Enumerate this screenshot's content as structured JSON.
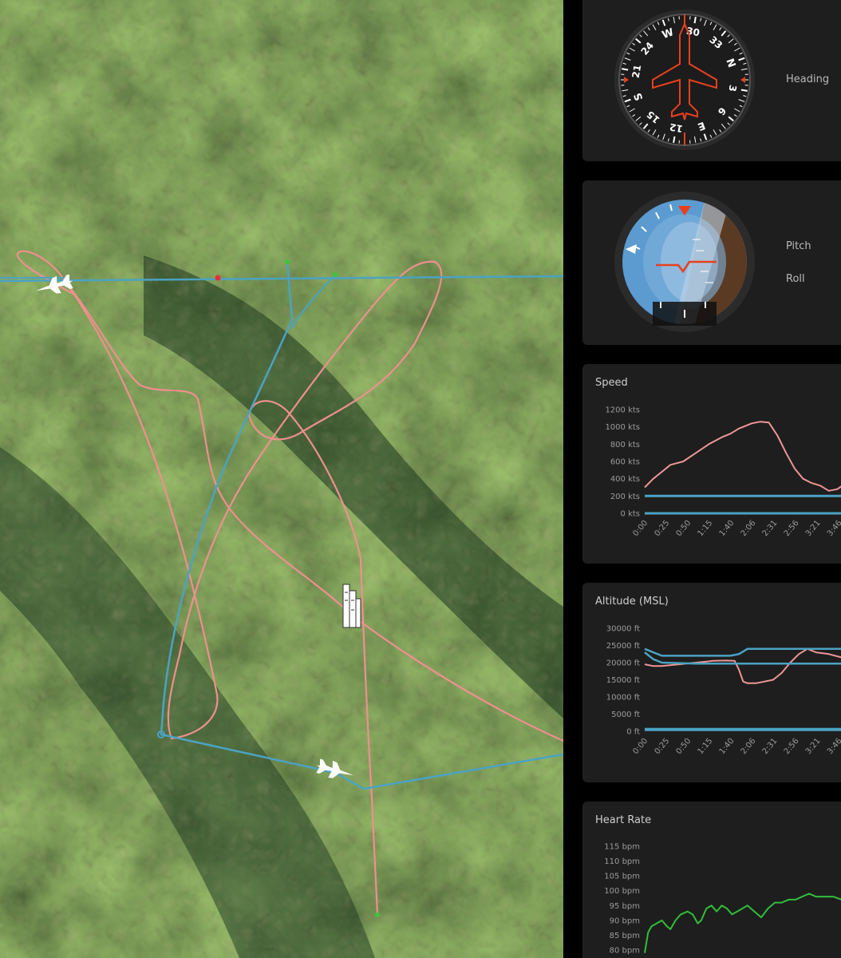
{
  "map": {
    "colors": {
      "track_red": "#ef8f8f",
      "track_blue": "#4aa3c4",
      "waypoint_green": "#37c837",
      "waypoint_red": "#e83030"
    },
    "icons": [
      "fighter-jet-icon",
      "fighter-jet-icon",
      "city-tower-icon"
    ]
  },
  "heading": {
    "label": "Heading",
    "dial_labels": [
      "30",
      "33",
      "N",
      "3",
      "6",
      "E",
      "12",
      "15",
      "S",
      "21",
      "24",
      "W"
    ]
  },
  "attitude": {
    "pitch_label": "Pitch",
    "roll_label": "Roll"
  },
  "speed_chart": {
    "title": "Speed",
    "accent": "#ef9696",
    "ref_color": "#4aa3c4"
  },
  "altitude_chart": {
    "title": "Altitude (MSL)",
    "accent": "#ef9696",
    "ref_color": "#4aa3c4"
  },
  "heart_chart": {
    "title": "Heart Rate",
    "accent": "#2fbf3a"
  },
  "chart_data": [
    {
      "type": "line",
      "title": "Speed",
      "xlabel": "",
      "ylabel": "",
      "x": [
        "0:00",
        "0:25",
        "0:50",
        "1:15",
        "1:40",
        "2:06",
        "2:31",
        "2:56",
        "3:21",
        "3:46"
      ],
      "yticks": [
        "0 kts",
        "200 kts",
        "400 kts",
        "600 kts",
        "800 kts",
        "1000 kts",
        "1200 kts"
      ],
      "ylim": [
        0,
        1200
      ],
      "xlim": [
        0,
        246
      ],
      "series": [
        {
          "x": [
            0,
            10,
            20,
            30,
            45,
            60,
            75,
            90,
            100,
            110,
            115,
            125,
            135,
            145,
            155,
            165,
            175,
            185,
            195,
            205,
            215,
            225,
            235,
            240,
            246
          ],
          "values": [
            300,
            400,
            480,
            560,
            600,
            700,
            800,
            880,
            920,
            980,
            1000,
            1040,
            1060,
            1050,
            900,
            700,
            520,
            400,
            350,
            320,
            260,
            280,
            350,
            400,
            420
          ]
        },
        {
          "x": [
            0,
            246
          ],
          "values": [
            200,
            200
          ]
        },
        {
          "x": [
            0,
            246
          ],
          "values": [
            0,
            0
          ]
        }
      ]
    },
    {
      "type": "line",
      "title": "Altitude (MSL)",
      "xlabel": "",
      "ylabel": "",
      "x": [
        "0:00",
        "0:25",
        "0:50",
        "1:15",
        "1:40",
        "2:06",
        "2:31",
        "2:56",
        "3:21",
        "3:46"
      ],
      "yticks": [
        "0 ft",
        "5000 ft",
        "10000 ft",
        "15000 ft",
        "20000 ft",
        "25000 ft",
        "30000 ft"
      ],
      "ylim": [
        0,
        30000
      ],
      "xlim": [
        0,
        246
      ],
      "series": [
        {
          "x": [
            0,
            10,
            20,
            40,
            60,
            80,
            95,
            105,
            110,
            115,
            120,
            130,
            140,
            150,
            160,
            170,
            180,
            190,
            200,
            215,
            230,
            246
          ],
          "values": [
            19500,
            19000,
            19000,
            19500,
            20000,
            20500,
            20600,
            20500,
            18000,
            14500,
            14000,
            14000,
            14500,
            15000,
            17000,
            20000,
            22500,
            24000,
            23000,
            22500,
            21500,
            20500
          ]
        },
        {
          "x": [
            0,
            10,
            20,
            60,
            100,
            110,
            120,
            140,
            180,
            220,
            246
          ],
          "values": [
            24000,
            23000,
            22000,
            22000,
            22000,
            22500,
            24000,
            24000,
            24000,
            24000,
            24000
          ]
        },
        {
          "x": [
            0,
            10,
            20,
            60,
            100,
            140,
            180,
            220,
            246
          ],
          "values": [
            23000,
            21000,
            20000,
            19700,
            19700,
            19700,
            19700,
            19700,
            19700
          ]
        },
        {
          "x": [
            0,
            246
          ],
          "values": [
            500,
            500
          ]
        }
      ]
    },
    {
      "type": "line",
      "title": "Heart Rate",
      "xlabel": "",
      "ylabel": "",
      "yticks": [
        "80 bpm",
        "85 bpm",
        "90 bpm",
        "95 bpm",
        "100 bpm",
        "105 bpm",
        "110 bpm",
        "115 bpm"
      ],
      "ylim": [
        80,
        115
      ],
      "xlim": [
        0,
        246
      ],
      "series": [
        {
          "x": [
            0,
            4,
            8,
            14,
            20,
            26,
            30,
            36,
            42,
            50,
            56,
            62,
            66,
            72,
            78,
            84,
            90,
            96,
            102,
            108,
            114,
            120,
            128,
            136,
            144,
            152,
            160,
            168,
            176,
            184,
            192,
            200,
            210,
            220,
            230,
            240,
            244,
            246
          ],
          "values": [
            79,
            86,
            88,
            89,
            90,
            88,
            87,
            90,
            92,
            93,
            92,
            89,
            90,
            94,
            95,
            93,
            95,
            94,
            92,
            93,
            94,
            95,
            93,
            91,
            94,
            96,
            96,
            97,
            97,
            98,
            99,
            98,
            98,
            98,
            97,
            97,
            97,
            88
          ]
        }
      ]
    }
  ]
}
